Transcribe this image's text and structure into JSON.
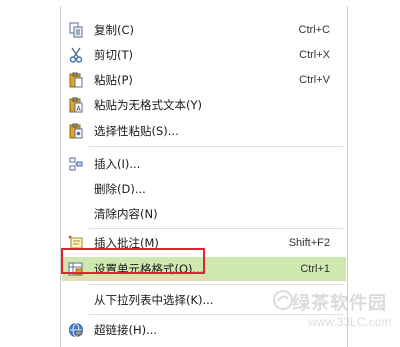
{
  "menu": {
    "items": [
      {
        "label": "复制(C)",
        "shortcut": "Ctrl+C",
        "icon": "copy-icon"
      },
      {
        "label": "剪切(T)",
        "shortcut": "Ctrl+X",
        "icon": "scissors-icon"
      },
      {
        "label": "粘贴(P)",
        "shortcut": "Ctrl+V",
        "icon": "paste-icon"
      },
      {
        "label": "粘贴为无格式文本(Y)",
        "shortcut": "",
        "icon": "paste-plain-icon"
      },
      {
        "label": "选择性粘贴(S)...",
        "shortcut": "",
        "icon": "paste-special-icon"
      },
      {
        "label": "插入(I)...",
        "shortcut": "",
        "icon": "insert-icon"
      },
      {
        "label": "删除(D)...",
        "shortcut": "",
        "icon": ""
      },
      {
        "label": "清除内容(N)",
        "shortcut": "",
        "icon": ""
      },
      {
        "label": "插入批注(M)",
        "shortcut": "Shift+F2",
        "icon": "comment-icon"
      },
      {
        "label": "设置单元格格式(O)...",
        "shortcut": "Ctrl+1",
        "icon": "format-cells-icon"
      },
      {
        "label": "从下拉列表中选择(K)...",
        "shortcut": "",
        "icon": ""
      },
      {
        "label": "超链接(H)...",
        "shortcut": "",
        "icon": "hyperlink-icon"
      }
    ]
  },
  "watermark": {
    "site_name": "绿茶软件园",
    "url": "www.33LC.com"
  },
  "colors": {
    "highlight": "#cfe8b0",
    "annotation_border": "#e0242b"
  }
}
